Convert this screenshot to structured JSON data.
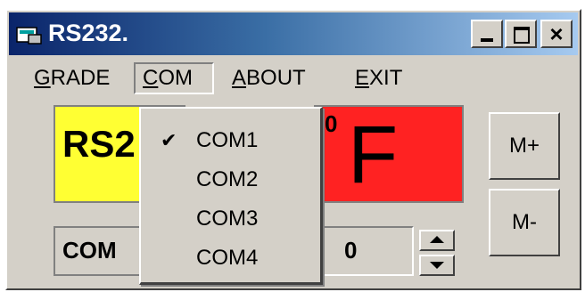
{
  "window": {
    "title": "RS232.",
    "close_glyph": "×",
    "title_gradient": [
      "#0a246a",
      "#a6caf0"
    ],
    "face_color": "#d4d0c8"
  },
  "menu": {
    "grade": {
      "accel": "G",
      "rest": "RADE"
    },
    "com": {
      "accel": "C",
      "rest": "OM"
    },
    "about": {
      "accel": "A",
      "rest": "BOUT"
    },
    "exit": {
      "accel": "E",
      "rest": "XIT"
    }
  },
  "display": {
    "yellow_panel_text": "RS2",
    "yellow_color": "#ffff33",
    "red_panel_sup": "0",
    "red_panel_text": "F",
    "red_color": "#ff2222"
  },
  "buttons": {
    "m_plus": "M+",
    "m_minus": "M-"
  },
  "status": {
    "com_label": "COM",
    "value": "0"
  },
  "com_dropdown": {
    "items": [
      {
        "label": "COM1",
        "checked": true,
        "check": "✔"
      },
      {
        "label": "COM2",
        "checked": false,
        "check": ""
      },
      {
        "label": "COM3",
        "checked": false,
        "check": ""
      },
      {
        "label": "COM4",
        "checked": false,
        "check": ""
      }
    ]
  },
  "icons": [
    "app-icon",
    "minimize-icon",
    "maximize-icon",
    "close-icon",
    "checkmark-icon",
    "spin-up-icon",
    "spin-down-icon"
  ]
}
